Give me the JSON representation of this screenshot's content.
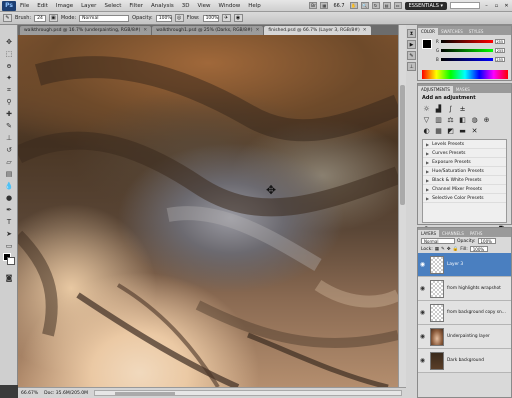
{
  "menu": [
    "File",
    "Edit",
    "Image",
    "Layer",
    "Select",
    "Filter",
    "Analysis",
    "3D",
    "View",
    "Window",
    "Help"
  ],
  "app": {
    "logo": "Ps",
    "zoom": "66.7",
    "workspace": "ESSENTIALS ▾"
  },
  "options": {
    "brush_label": "Brush:",
    "brush_size": "24",
    "mode_label": "Mode:",
    "mode_value": "Normal",
    "opacity_label": "Opacity:",
    "opacity_value": "100%",
    "flow_label": "Flow:",
    "flow_value": "100%"
  },
  "tabs": [
    {
      "label": "walkthrough.psd @ 16.7% (underpainting, RGB/8#)"
    },
    {
      "label": "walkthrough1.psd @ 25% (Darks, RGB/8#)"
    },
    {
      "label": "finished.psd @ 66.7% (Layer 3, RGB/8#)"
    }
  ],
  "status": {
    "zoom": "66.67%",
    "doc": "Doc: 35.6M/205.0M"
  },
  "color_panel": {
    "tabs": [
      "COLOR",
      "SWATCHES",
      "STYLES"
    ],
    "channels": [
      {
        "label": "R",
        "value": "255"
      },
      {
        "label": "G",
        "value": "255"
      },
      {
        "label": "B",
        "value": "255"
      }
    ]
  },
  "adjustments": {
    "tabs": [
      "ADJUSTMENTS",
      "MASKS"
    ],
    "title": "Add an adjustment",
    "presets": [
      "Levels Presets",
      "Curves Presets",
      "Exposure Presets",
      "Hue/Saturation Presets",
      "Black & White Presets",
      "Channel Mixer Presets",
      "Selective Color Presets"
    ]
  },
  "layers_panel": {
    "tabs": [
      "LAYERS",
      "CHANNELS",
      "PATHS"
    ],
    "blend_mode": "Normal",
    "opacity_label": "Opacity:",
    "opacity_value": "100%",
    "lock_label": "Lock:",
    "fill_label": "Fill:",
    "fill_value": "100%",
    "layers": [
      {
        "name": "Layer 3",
        "selected": true
      },
      {
        "name": "from highlights wrapshot",
        "selected": false
      },
      {
        "name": "from background copy sn...",
        "selected": false
      },
      {
        "name": "Underpainting layer",
        "selected": false
      },
      {
        "name": "Dark background",
        "selected": false
      }
    ]
  }
}
